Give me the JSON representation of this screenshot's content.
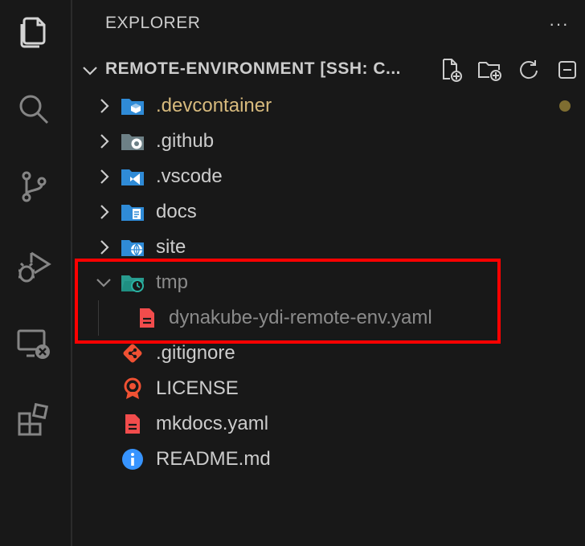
{
  "explorer": {
    "title": "EXPLORER",
    "more": "···"
  },
  "section": {
    "title": "REMOTE-ENVIRONMENT [SSH: C..."
  },
  "tree": [
    {
      "label": ".devcontainer",
      "color": "#d7ba7d",
      "modified": true
    },
    {
      "label": ".github",
      "color": "#cccccc"
    },
    {
      "label": ".vscode",
      "color": "#cccccc"
    },
    {
      "label": "docs",
      "color": "#cccccc"
    },
    {
      "label": "site",
      "color": "#cccccc"
    },
    {
      "label": "tmp",
      "color": "#8b8b8b",
      "expanded": true,
      "ignored": true
    },
    {
      "label": "dynakube-ydi-remote-env.yaml",
      "color": "#8b8b8b",
      "ignored": true
    },
    {
      "label": ".gitignore",
      "color": "#cccccc"
    },
    {
      "label": "LICENSE",
      "color": "#cccccc"
    },
    {
      "label": "mkdocs.yaml",
      "color": "#cccccc"
    },
    {
      "label": "README.md",
      "color": "#cccccc"
    }
  ],
  "colors": {
    "folder_blue": "#2f8bd7",
    "yaml_red": "#f14c4c",
    "git_orange": "#f05133",
    "license_orange": "#f05133",
    "info_blue": "#3794ff",
    "tmp_folder_teal": "#2bb3a3",
    "highlight": "#ff0000"
  }
}
